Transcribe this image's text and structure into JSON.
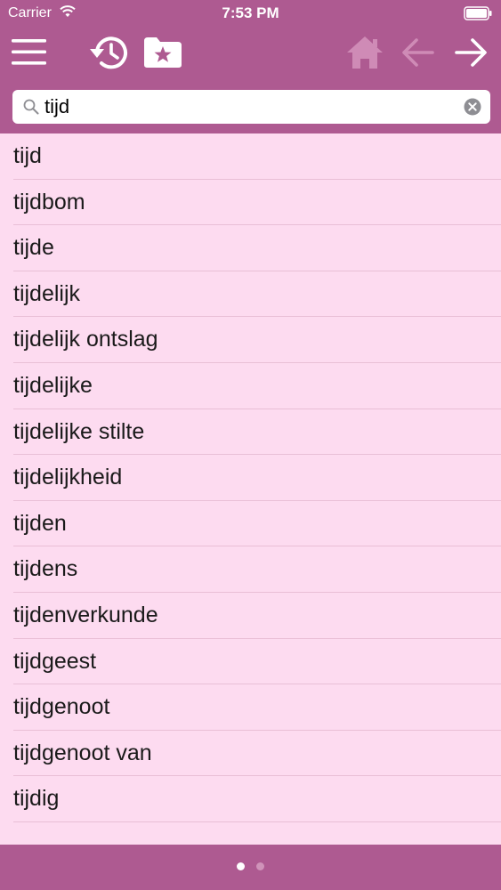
{
  "status_bar": {
    "carrier": "Carrier",
    "time": "7:53 PM",
    "wifi_icon": "wifi-icon",
    "battery_icon": "battery-icon"
  },
  "toolbar": {
    "icons": [
      "menu-icon",
      "history-icon",
      "favorites-folder-icon",
      "home-icon",
      "back-arrow-icon",
      "forward-arrow-icon"
    ],
    "disabled": [
      "home",
      "back"
    ]
  },
  "search": {
    "value": "tijd",
    "placeholder": ""
  },
  "words": [
    "tijd",
    "tijdbom",
    "tijde",
    "tijdelijk",
    "tijdelijk ontslag",
    "tijdelijke",
    "tijdelijke stilte",
    "tijdelijkheid",
    "tijden",
    "tijdens",
    "tijdenverkunde",
    "tijdgeest",
    "tijdgenoot",
    "tijdgenoot van",
    "tijdig"
  ],
  "pager": {
    "pages": 2,
    "current": 1
  },
  "colors": {
    "bar": "#ae5a91",
    "list_background": "#fddbf0",
    "icon_active": "#ffffff",
    "icon_disabled": "#cf8bb6"
  }
}
